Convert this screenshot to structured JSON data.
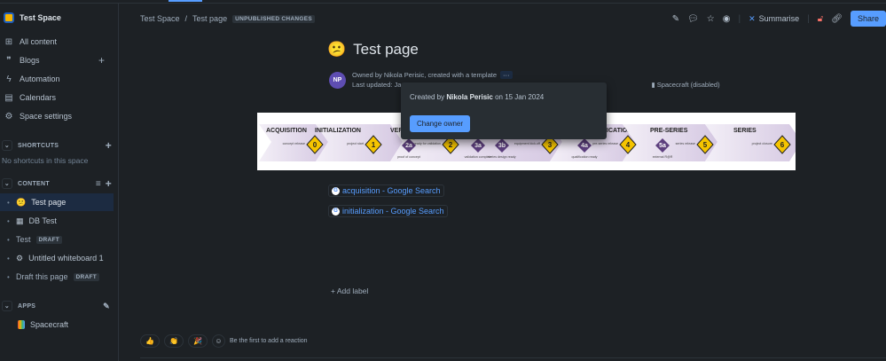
{
  "sidebar": {
    "space_name": "Test Space",
    "nav": [
      {
        "label": "All content",
        "icon": "grid-icon"
      },
      {
        "label": "Blogs",
        "icon": "quote-icon"
      },
      {
        "label": "Automation",
        "icon": "lightning-icon"
      },
      {
        "label": "Calendars",
        "icon": "calendar-icon"
      },
      {
        "label": "Space settings",
        "icon": "gear-icon"
      }
    ],
    "shortcuts": {
      "title": "SHORTCUTS",
      "empty": "No shortcuts in this space"
    },
    "content": {
      "title": "CONTENT",
      "items": [
        {
          "label": "Test page",
          "icon": "😕",
          "badge": ""
        },
        {
          "label": "DB Test",
          "icon": "▦",
          "badge": ""
        },
        {
          "label": "Test",
          "icon": "",
          "badge": "DRAFT"
        },
        {
          "label": "Untitled whiteboard 1",
          "icon": "⚙",
          "badge": ""
        },
        {
          "label": "Draft this page",
          "icon": "",
          "badge": "DRAFT"
        }
      ]
    },
    "apps": {
      "title": "APPS",
      "items": [
        {
          "label": "Spacecraft"
        }
      ]
    }
  },
  "breadcrumb": {
    "space": "Test Space",
    "sep": "/",
    "page": "Test page",
    "status": "UNPUBLISHED CHANGES"
  },
  "toolbar": {
    "summarise": "Summarise",
    "share": "Share"
  },
  "page": {
    "emoji": "😕",
    "title": "Test page",
    "avatar": "NP",
    "owner_line": "Owned by Nikola Perisic, created with a template",
    "more": "···",
    "updated_line": "Last updated: Ja",
    "app_status": "Spacecraft (disabled)",
    "links": [
      "acquisition - Google Search",
      "initialization - Google Search"
    ],
    "add_label": "+ Add label",
    "reaction_prompt": "Be the first to add a reaction",
    "reactions": [
      "👍",
      "👏",
      "🎉"
    ]
  },
  "popup": {
    "prefix": "Created by ",
    "author": "Nikola Perisic",
    "suffix": " on 15 Jan 2024",
    "button": "Change owner"
  },
  "roadmap": {
    "stages": [
      "ACQUISITION",
      "INITIALIZATION",
      "VERIFICATION",
      "QUALIFICATION",
      "PRE-SERIES",
      "SERIES"
    ],
    "milestones": [
      {
        "id": "0",
        "label": "concept release",
        "type": "gate"
      },
      {
        "id": "1",
        "label": "project start",
        "type": "gate"
      },
      {
        "id": "2a",
        "label": "proof of concept",
        "type": "sub"
      },
      {
        "id": "2",
        "label": "ready for validation",
        "type": "gate"
      },
      {
        "id": "3a",
        "label": "validation complete",
        "type": "sub"
      },
      {
        "id": "3b",
        "label": "series design ready",
        "type": "sub"
      },
      {
        "id": "3",
        "label": "equipment kick-off",
        "type": "gate"
      },
      {
        "id": "4a",
        "label": "qualification ready",
        "type": "sub"
      },
      {
        "id": "4",
        "label": "pre-series release",
        "type": "gate"
      },
      {
        "id": "5a",
        "label": "external R@R",
        "type": "sub"
      },
      {
        "id": "5",
        "label": "series release",
        "type": "gate"
      },
      {
        "id": "6",
        "label": "project closure",
        "type": "gate"
      }
    ]
  }
}
